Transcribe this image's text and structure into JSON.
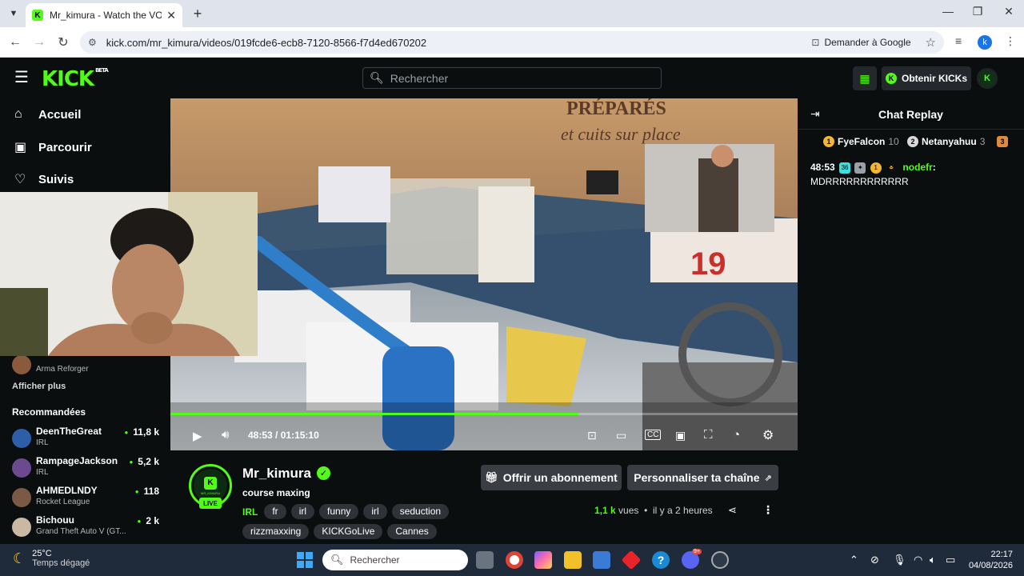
{
  "browser": {
    "tab_title": "Mr_kimura - Watch the VOD on",
    "tab_favicon": "K",
    "url": "kick.com/mr_kimura/videos/019fcde6-ecb8-7120-8566-f7d4ed670202",
    "ask_google": "Demander à Google",
    "profile_initial": "k"
  },
  "header": {
    "logo": "KICK",
    "beta": "BETA",
    "search_placeholder": "Rechercher",
    "kicks_button": "Obtenir KICKs"
  },
  "sidebar": {
    "nav": [
      {
        "label": "Accueil",
        "icon": "home-icon"
      },
      {
        "label": "Parcourir",
        "icon": "browse-icon"
      },
      {
        "label": "Suivis",
        "icon": "heart-icon"
      }
    ],
    "partial_channel_category": "Arma Reforger",
    "show_more": "Afficher plus",
    "recommended_title": "Recommandées",
    "recommended": [
      {
        "name": "DeenTheGreat",
        "category": "IRL",
        "viewers": "11,8 k"
      },
      {
        "name": "RampageJackson",
        "category": "IRL",
        "viewers": "5,2 k"
      },
      {
        "name": "AHMEDLNDY",
        "category": "Rocket League",
        "viewers": "118"
      },
      {
        "name": "Bichouu",
        "category": "Grand Theft Auto V (GT...",
        "viewers": "2 k"
      }
    ]
  },
  "player": {
    "current_time": "48:53",
    "separator": "/",
    "duration": "01:15:10",
    "progress": 0.65,
    "overlay_sign_1": "PRÉPARÉS",
    "overlay_sign_2": "et cuits sur place"
  },
  "channel": {
    "name": "Mr_kimura",
    "live_badge": "LIVE",
    "avatar_text": "K",
    "avatar_sub": "MR_KIMURA",
    "stream_title": "course maxing",
    "category": "IRL",
    "tags": [
      "fr",
      "irl",
      "funny",
      "irl",
      "seduction",
      "rizzmaxxing",
      "KICKGoLive",
      "Cannes"
    ],
    "gift_button": "Offrir un abonnement",
    "customize_button": "Personnaliser ta chaîne",
    "views": "1,1 k",
    "views_label": "vues",
    "dot": "•",
    "time_ago": "il y a 2 heures"
  },
  "chat": {
    "title": "Chat Replay",
    "leaderboard": [
      {
        "rank": "1",
        "name": "FyeFalcon",
        "count": "10",
        "color": "#f5b731"
      },
      {
        "rank": "2",
        "name": "Netanyahuu",
        "count": "3",
        "color": "#d9d9d9"
      },
      {
        "rank": "3",
        "name": "",
        "count": "",
        "color": "#e08a3c"
      }
    ],
    "messages": [
      {
        "time": "48:53",
        "badge_num": "36",
        "badge_gift": "1",
        "user": "nodefr",
        "text": "MDRRRRRRRRRRRR"
      }
    ]
  },
  "taskbar": {
    "temperature": "25°C",
    "weather": "Temps dégagé",
    "search_placeholder": "Rechercher",
    "time": "22:17",
    "date": "04/08/2026",
    "discord_badge": "9+"
  },
  "colors": {
    "kick_green": "#53fc18",
    "bg": "#0b0e0f"
  }
}
